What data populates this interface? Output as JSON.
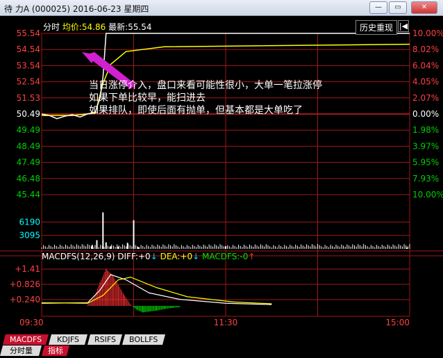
{
  "window": {
    "title": "待  力A (000025) 2016-06-23 星期四",
    "buttons": [
      "—",
      "▭",
      "✕"
    ]
  },
  "header": {
    "mode": "分时",
    "avg_label": "均价:",
    "avg_value": "54.86",
    "last_label": "最新:",
    "last_value": "55.54",
    "history_button": "历史重现",
    "nav_icon": "|◀"
  },
  "price_axis": {
    "left": [
      "55.54",
      "54.54",
      "53.54",
      "52.54",
      "51.53",
      "50.49",
      "49.49",
      "48.49",
      "47.49",
      "46.48",
      "45.44"
    ],
    "right": [
      "10.00%",
      "8.02%",
      "6.04%",
      "4.05%",
      "2.07%",
      "0.00%",
      "1.98%",
      "3.97%",
      "5.95%",
      "7.93%",
      "10.00%"
    ],
    "base": 50.49
  },
  "volume_axis": {
    "labels": [
      "6190",
      "3095"
    ]
  },
  "annotation": {
    "lines": [
      "当日涨停介入，盘口来看可能性很小，大单一笔拉涨停",
      "如果下单比较早，能扫进去",
      "如果排队，即使后面有抛单，但基本都是大单吃了"
    ]
  },
  "macd": {
    "title": "MACDFS(12,26,9)",
    "diff_label": "DIFF:",
    "diff_value": "+0",
    "dea_label": "DEA:",
    "dea_value": "+0",
    "macdfs_label": "MACDFS:",
    "macdfs_value": "-0",
    "axis": [
      "+1.41",
      "+0.826",
      "+0.240"
    ]
  },
  "time_axis": [
    "09:30",
    "11:30",
    "15:00"
  ],
  "bottom_tabs": [
    "MACDFS",
    "KDJFS",
    "RSIFS",
    "BOLLFS"
  ],
  "bottom_tabs2": [
    "分时量",
    "指标"
  ],
  "colors": {
    "grid": "#a01818",
    "price": "#ffffff",
    "avg": "#ffff00",
    "up": "#ff3030",
    "down": "#00e000",
    "axis_text_up": "#ff4040",
    "axis_text_down": "#00d000",
    "volume_axis_text": "#00ffff"
  },
  "chart_data": {
    "type": "line",
    "price_series": [
      {
        "t": 0,
        "p": 50.49
      },
      {
        "t": 5,
        "p": 50.4
      },
      {
        "t": 10,
        "p": 50.2
      },
      {
        "t": 15,
        "p": 50.35
      },
      {
        "t": 20,
        "p": 50.45
      },
      {
        "t": 25,
        "p": 50.3
      },
      {
        "t": 30,
        "p": 50.5
      },
      {
        "t": 35,
        "p": 50.6
      },
      {
        "t": 38,
        "p": 51.5
      },
      {
        "t": 40,
        "p": 52.8
      },
      {
        "t": 42,
        "p": 55.54
      },
      {
        "t": 50,
        "p": 55.54
      },
      {
        "t": 240,
        "p": 55.54
      }
    ],
    "avg_series": [
      {
        "t": 0,
        "p": 50.4
      },
      {
        "t": 20,
        "p": 50.4
      },
      {
        "t": 35,
        "p": 50.55
      },
      {
        "t": 40,
        "p": 52.4
      },
      {
        "t": 45,
        "p": 53.6
      },
      {
        "t": 55,
        "p": 54.4
      },
      {
        "t": 80,
        "p": 54.7
      },
      {
        "t": 240,
        "p": 54.86
      }
    ],
    "volume": [
      {
        "t": 33,
        "v": 900
      },
      {
        "t": 36,
        "v": 2000
      },
      {
        "t": 40,
        "v": 8400
      },
      {
        "t": 42,
        "v": 1500
      },
      {
        "t": 45,
        "v": 600
      },
      {
        "t": 50,
        "v": 500
      },
      {
        "t": 56,
        "v": 1400
      },
      {
        "t": 60,
        "v": 6600
      },
      {
        "t": 63,
        "v": 400
      },
      {
        "t": 120,
        "v": 600
      },
      {
        "t": 238,
        "v": 300
      }
    ],
    "macd_hist": [
      {
        "t": 30,
        "v": 0.05
      },
      {
        "t": 34,
        "v": 0.3
      },
      {
        "t": 38,
        "v": 0.9
      },
      {
        "t": 42,
        "v": 1.41
      },
      {
        "t": 46,
        "v": 1.2
      },
      {
        "t": 50,
        "v": 0.8
      },
      {
        "t": 54,
        "v": 0.4
      },
      {
        "t": 58,
        "v": 0.05
      },
      {
        "t": 62,
        "v": -0.15
      },
      {
        "t": 66,
        "v": -0.25
      },
      {
        "t": 70,
        "v": -0.22
      },
      {
        "t": 75,
        "v": -0.18
      },
      {
        "t": 80,
        "v": -0.12
      },
      {
        "t": 85,
        "v": -0.08
      },
      {
        "t": 90,
        "v": -0.05
      }
    ],
    "macd_diff": [
      {
        "t": 0,
        "v": 0.1
      },
      {
        "t": 30,
        "v": 0.12
      },
      {
        "t": 38,
        "v": 0.6
      },
      {
        "t": 45,
        "v": 1.2
      },
      {
        "t": 55,
        "v": 1.0
      },
      {
        "t": 70,
        "v": 0.5
      },
      {
        "t": 90,
        "v": 0.25
      },
      {
        "t": 120,
        "v": 0.1
      },
      {
        "t": 150,
        "v": 0.05
      }
    ],
    "macd_dea": [
      {
        "t": 0,
        "v": 0.12
      },
      {
        "t": 30,
        "v": 0.1
      },
      {
        "t": 40,
        "v": 0.4
      },
      {
        "t": 50,
        "v": 1.0
      },
      {
        "t": 58,
        "v": 1.1
      },
      {
        "t": 75,
        "v": 0.7
      },
      {
        "t": 95,
        "v": 0.35
      },
      {
        "t": 125,
        "v": 0.15
      },
      {
        "t": 150,
        "v": 0.08
      }
    ],
    "xlim": [
      0,
      240
    ],
    "ylim": [
      45.44,
      55.54
    ]
  }
}
